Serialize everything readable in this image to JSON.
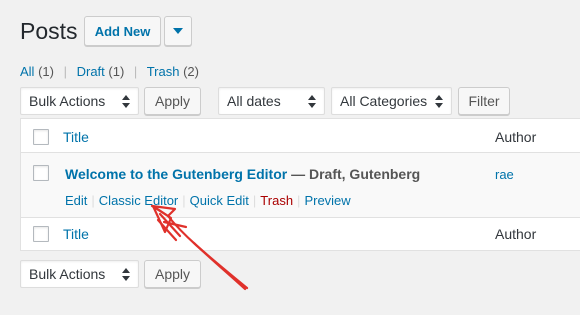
{
  "header": {
    "title": "Posts",
    "add_new_label": "Add New"
  },
  "views": [
    {
      "label": "All",
      "count": "(1)"
    },
    {
      "label": "Draft",
      "count": "(1)"
    },
    {
      "label": "Trash",
      "count": "(2)"
    }
  ],
  "filters": {
    "bulk_actions": "Bulk Actions",
    "apply": "Apply",
    "dates": "All dates",
    "categories": "All Categories",
    "filter": "Filter"
  },
  "table": {
    "columns": {
      "title": "Title",
      "author": "Author"
    },
    "rows": [
      {
        "title": "Welcome to the Gutenberg Editor",
        "state": " — Draft, Gutenberg",
        "author": "rae",
        "actions": [
          "Edit",
          "Classic Editor",
          "Quick Edit",
          "Trash",
          "Preview"
        ]
      }
    ]
  },
  "bottom": {
    "bulk_actions": "Bulk Actions",
    "apply": "Apply"
  },
  "colors": {
    "link": "#0073aa",
    "trash": "#aa0000",
    "annotation": "#e0312b"
  }
}
